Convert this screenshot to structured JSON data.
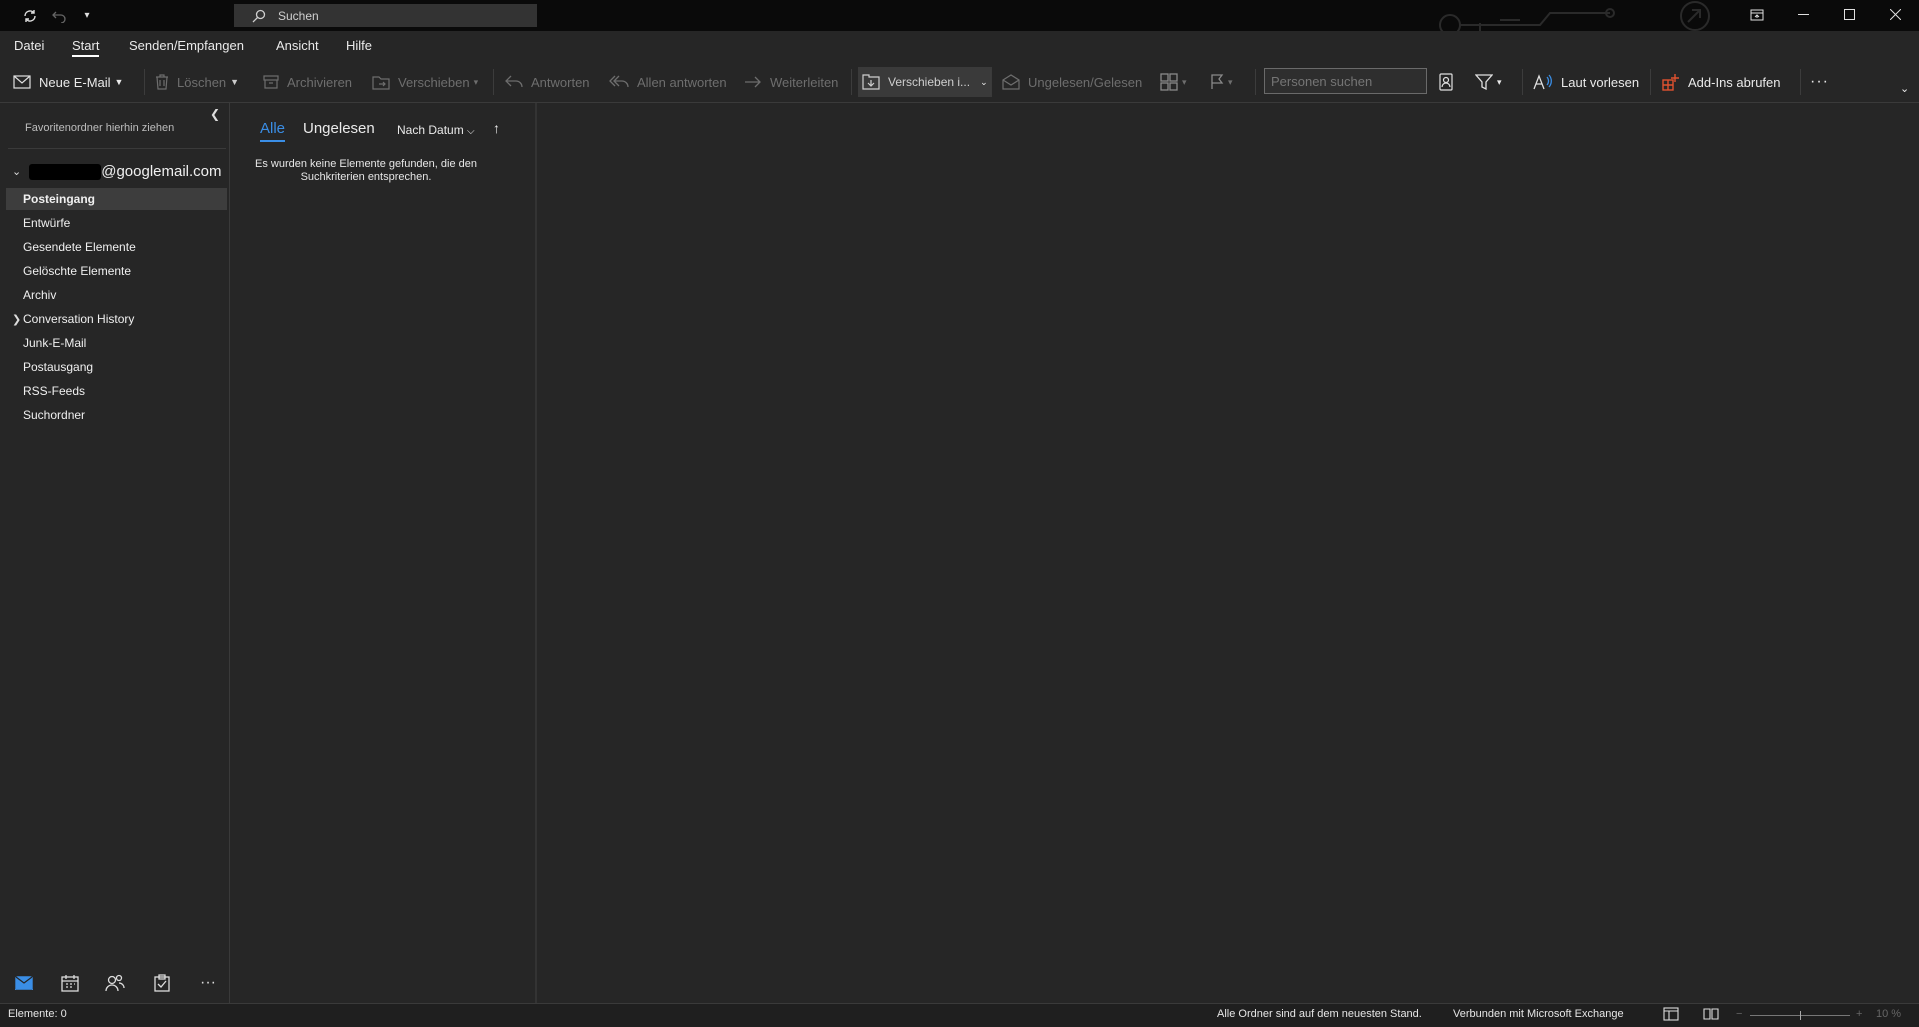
{
  "titlebar": {
    "search_placeholder": "Suchen",
    "quick_access": [
      "sync-icon",
      "undo-icon",
      "customize-icon"
    ],
    "window_buttons": [
      "restore-layout-icon",
      "minimize-icon",
      "maximize-icon",
      "close-icon"
    ]
  },
  "menu": {
    "items": [
      "Datei",
      "Start",
      "Senden/Empfangen",
      "Ansicht",
      "Hilfe"
    ],
    "active": "Start"
  },
  "ribbon": {
    "new_mail": "Neue E-Mail",
    "delete": "Löschen",
    "archive": "Archivieren",
    "move": "Verschieben",
    "reply": "Antworten",
    "reply_all": "Allen antworten",
    "forward": "Weiterleiten",
    "move_to": "Verschieben i...",
    "unread_read": "Ungelesen/Gelesen",
    "people_search_placeholder": "Personen suchen",
    "read_aloud": "Laut vorlesen",
    "get_addins": "Add-Ins abrufen",
    "more": "···"
  },
  "folderpane": {
    "fav_hint": "Favoritenordner hierhin ziehen",
    "account_suffix": "@googlemail.com",
    "folders": [
      {
        "label": "Posteingang",
        "selected": true,
        "expandable": false
      },
      {
        "label": "Entwürfe",
        "selected": false,
        "expandable": false
      },
      {
        "label": "Gesendete Elemente",
        "selected": false,
        "expandable": false
      },
      {
        "label": "Gelöschte Elemente",
        "selected": false,
        "expandable": false
      },
      {
        "label": "Archiv",
        "selected": false,
        "expandable": false
      },
      {
        "label": "Conversation History",
        "selected": false,
        "expandable": true
      },
      {
        "label": "Junk-E-Mail",
        "selected": false,
        "expandable": false
      },
      {
        "label": "Postausgang",
        "selected": false,
        "expandable": false
      },
      {
        "label": "RSS-Feeds",
        "selected": false,
        "expandable": false
      },
      {
        "label": "Suchordner",
        "selected": false,
        "expandable": false
      }
    ]
  },
  "msglist": {
    "tab_all": "Alle",
    "tab_unread": "Ungelesen",
    "sort_label": "Nach Datum",
    "empty_message": "Es wurden keine Elemente gefunden, die den Suchkriterien entsprechen."
  },
  "statusbar": {
    "items_count": "Elemente: 0",
    "sync_status": "Alle Ordner sind auf dem neuesten Stand.",
    "connection": "Verbunden mit Microsoft Exchange",
    "zoom": "10 %"
  },
  "colors": {
    "accent": "#3a8ee6",
    "addin_icon": "#e0522f",
    "background": "#262626",
    "titlebar": "#0a0a0a"
  }
}
